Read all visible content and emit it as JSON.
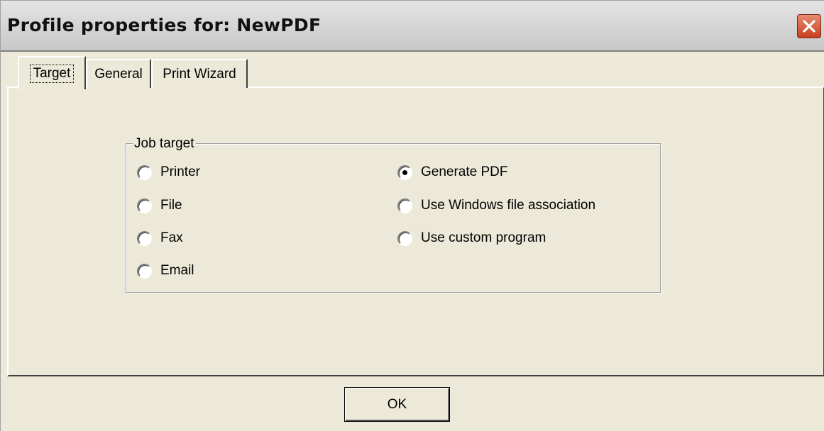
{
  "window": {
    "title": "Profile properties for: NewPDF"
  },
  "tabs": [
    {
      "label": "Target",
      "active": true
    },
    {
      "label": "General",
      "active": false
    },
    {
      "label": "Print Wizard",
      "active": false
    }
  ],
  "job_target": {
    "group_label": "Job target",
    "left_options": [
      {
        "label": "Printer",
        "checked": false
      },
      {
        "label": "File",
        "checked": false
      },
      {
        "label": "Fax",
        "checked": false
      },
      {
        "label": "Email",
        "checked": false
      }
    ],
    "right_options": [
      {
        "label": "Generate PDF",
        "checked": true
      },
      {
        "label": "Use Windows file association",
        "checked": false
      },
      {
        "label": "Use custom program",
        "checked": false
      }
    ]
  },
  "buttons": {
    "ok_label": "OK"
  },
  "colors": {
    "dialog_face": "#ECE9D8",
    "close_button": "#C8401F"
  }
}
